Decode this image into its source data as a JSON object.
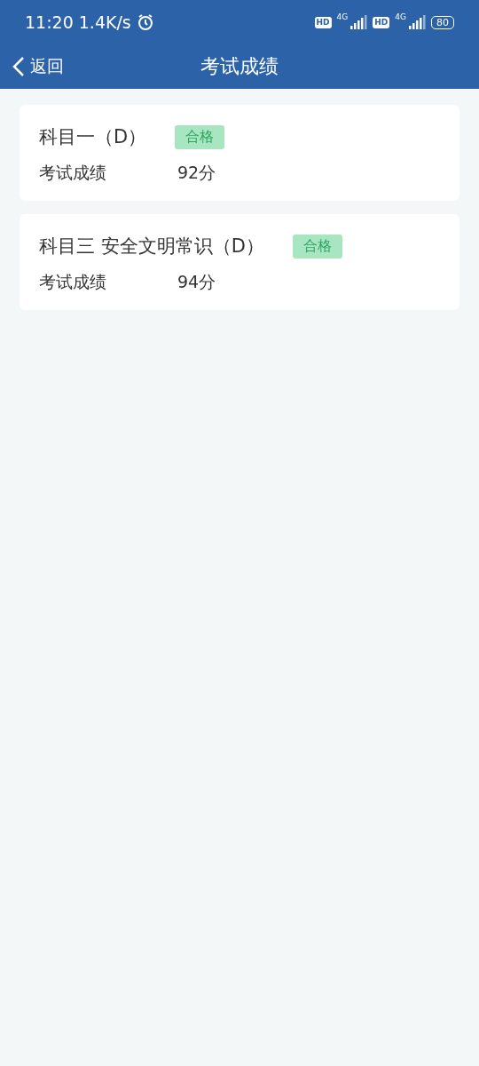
{
  "status_bar": {
    "time": "11:20",
    "speed": "1.4K/s",
    "sims": [
      {
        "hd": "HD",
        "network": "4G"
      },
      {
        "hd": "HD",
        "network": "4G"
      }
    ],
    "battery": "80"
  },
  "nav": {
    "back": "返回",
    "title": "考试成绩"
  },
  "results": [
    {
      "subject": "科目一（D）",
      "status": "合格",
      "label": "考试成绩",
      "score": "92分"
    },
    {
      "subject": "科目三 安全文明常识（D）",
      "status": "合格",
      "label": "考试成绩",
      "score": "94分"
    }
  ]
}
